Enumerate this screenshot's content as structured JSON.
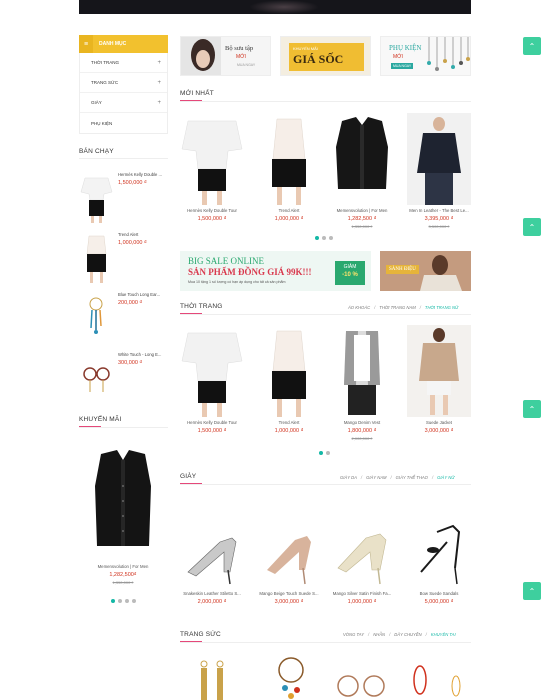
{
  "sidebar": {
    "category_title": "DANH MỤC",
    "categories": [
      {
        "label": "THỜI TRANG",
        "has_sub": true
      },
      {
        "label": "TRANG SỨC",
        "has_sub": true
      },
      {
        "label": "GIÀY",
        "has_sub": true
      },
      {
        "label": "PHỤ KIỆN",
        "has_sub": false
      }
    ],
    "bestseller_title": "BÁN CHẠY",
    "bestsellers": [
      {
        "name": "Hermès Kelly Double ...",
        "price": "1,500,000 ₫"
      },
      {
        "name": "Trend Alert",
        "price": "1,000,000 ₫"
      },
      {
        "name": "Blue Touch Long Ear...",
        "price": "200,000 ₫"
      },
      {
        "name": "White Touch - Long E...",
        "price": "300,000 ₫"
      }
    ],
    "promo_title": "KHUYẾN MÃI",
    "promo_product": {
      "name": "Memensvolution | For Men",
      "price": "1,282,500₫",
      "old_price": "1,350,000 ₫"
    }
  },
  "banners": {
    "b1": {
      "line1": "Bộ sưu tập",
      "line2": "MỚI",
      "line3": "MUA NGAY"
    },
    "b2": {
      "line1": "KHUYẾN MÃI",
      "line2": "GIÁ SỐC"
    },
    "b3": {
      "line1": "PHỤ KIỆN",
      "line2": "MỚI",
      "cta": "MUA NGAY"
    }
  },
  "newest": {
    "title": "MỚI NHẤT",
    "products": [
      {
        "name": "Hermès Kelly Double Tour",
        "price": "1,500,000 ₫",
        "old_price": ""
      },
      {
        "name": "Trend Alert",
        "price": "1,000,000 ₫",
        "old_price": ""
      },
      {
        "name": "Memensvolution | For Men",
        "price": "1,282,500 ₫",
        "old_price": "1,350,000 ₫"
      },
      {
        "name": "Men In Leather - The Best Le...",
        "price": "3,395,000 ₫",
        "old_price": "3,500,000 ₫"
      }
    ]
  },
  "sale_banner": {
    "line1": "BIG SALE ONLINE",
    "line2": "SẢN PHẨM ĐỒNG GIÁ 99K!!!",
    "line3": "Mua 10 tặng 1 số lượng có hạn áp dụng cho tất cả sản phẩm",
    "badge_top": "GIẢM",
    "badge_bottom": "-10 %",
    "side_tag": "SÀNH ĐIỆU"
  },
  "fashion": {
    "title": "THỜI TRANG",
    "tabs": [
      "ÁO KHOÁC",
      "THỜI TRANG NAM",
      "THỜI TRANG NỮ"
    ],
    "products": [
      {
        "name": "Hermès Kelly Double Tour",
        "price": "1,500,000 ₫",
        "old_price": ""
      },
      {
        "name": "Trend Alert",
        "price": "1,000,000 ₫",
        "old_price": ""
      },
      {
        "name": "Mango Denim Vest",
        "price": "1,800,000 ₫",
        "old_price": "2,000,000 ₫"
      },
      {
        "name": "Suede Jacket",
        "price": "3,000,000 ₫",
        "old_price": ""
      }
    ]
  },
  "shoes": {
    "title": "GIÀY",
    "tabs": [
      "GIÀY DA",
      "GIÀY NAM",
      "GIÀY THỂ THAO",
      "GIÀY NỮ"
    ],
    "products": [
      {
        "name": "Snakeskin Leather Stiletto S...",
        "price": "2,000,000 ₫"
      },
      {
        "name": "Mango Beige Touch Suede S...",
        "price": "3,000,000 ₫"
      },
      {
        "name": "Mango Silver Satin Finish Fa...",
        "price": "1,000,000 ₫"
      },
      {
        "name": "Bow Suede Sandals",
        "price": "5,000,000 ₫"
      }
    ]
  },
  "jewelry": {
    "title": "TRANG SỨC",
    "tabs": [
      "VÒNG TAY",
      "NHẪN",
      "DÂY CHUYỀN",
      "KHUYÊN TAI"
    ]
  },
  "colors": {
    "accent": "#14b8a6",
    "price": "#d0311d",
    "category_head": "#f2c12e",
    "float_button": "#3ecf9e"
  },
  "icons": {
    "float": "arrow-up-icon",
    "menu": "hamburger-icon",
    "expand": "plus-icon"
  }
}
